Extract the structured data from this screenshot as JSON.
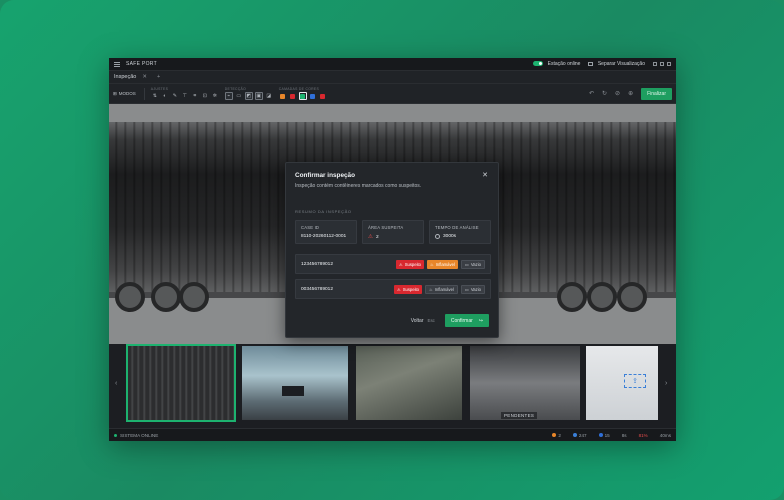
{
  "titlebar": {
    "app_name": "SAFE PORT",
    "station_label": "Estação online",
    "split_label": "Separar Visualização"
  },
  "tabs": [
    {
      "label": "Inspeção"
    }
  ],
  "toolbar": {
    "modes_label": "MODOS",
    "groups": {
      "adjust": "AJUSTES",
      "detection": "DETECÇÃO",
      "highlight": "CAMADAS DE CORES"
    },
    "finish_label": "Finalizar",
    "swatch_colors": [
      "#e8862a",
      "#d8282f",
      "#1db26f",
      "#2f6fd8",
      "#d8282f"
    ]
  },
  "modal": {
    "title": "Confirmar inspeção",
    "subtitle": "Inspeção contém contêineres marcados como suspeitos.",
    "section_label": "RESUMO DA INSPEÇÃO",
    "cards": [
      {
        "key": "CASE ID",
        "value": "8110-20260112-0001"
      },
      {
        "key": "ÁREA SUSPEITA",
        "value": "2"
      },
      {
        "key": "TEMPO DE ANÁLISE",
        "value": "3000s"
      }
    ],
    "containers": [
      {
        "id": "123456789012",
        "tags": [
          "Suspeito",
          "Inflamável",
          "Vazio"
        ]
      },
      {
        "id": "003456789012",
        "tags": [
          "Suspeito",
          "Inflamável",
          "Vazio"
        ]
      }
    ],
    "back_label": "Voltar",
    "back_key": "Esc",
    "confirm_label": "Confirmar"
  },
  "thumbnails": {
    "pending_label": "PENDENTES"
  },
  "statusbar": {
    "system_label": "SISTEMA ONLINE",
    "stats": [
      {
        "value": "2",
        "color": "#e8862a"
      },
      {
        "value": "247",
        "color": "#3a7fd8"
      },
      {
        "value": "15",
        "color": "#2f6fd8"
      }
    ],
    "extras": [
      "8s",
      "81%",
      "40ms"
    ]
  }
}
